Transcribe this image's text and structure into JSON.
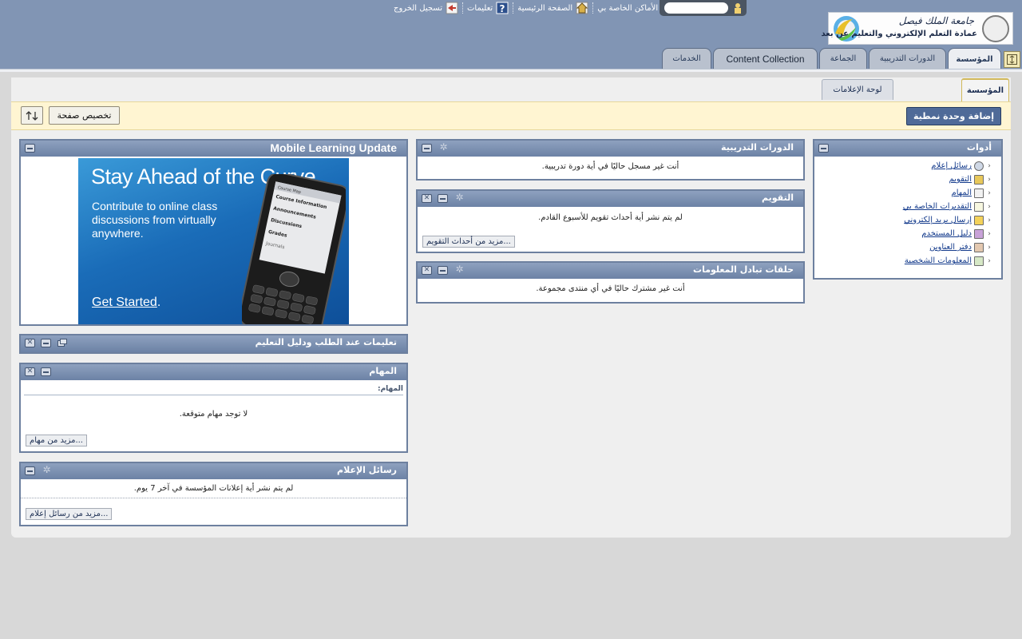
{
  "header": {
    "top_links": [
      {
        "label": "تسجيل الخروج",
        "icon": "logout-icon"
      },
      {
        "label": "تعليمات",
        "icon": "help-icon"
      },
      {
        "label": "الصفحة الرئيسية",
        "icon": "home-icon"
      },
      {
        "label": "الأماكن الخاصة بي",
        "icon": "my-places-icon"
      }
    ],
    "logo": {
      "line1": "جامعة الملك فيصل",
      "line2": "عمادة التعلم الإلكتروني والتعليم عن بعد"
    }
  },
  "tabs": [
    {
      "label": "المؤسسة",
      "active": true
    },
    {
      "label": "الدورات التدريبية",
      "active": false
    },
    {
      "label": "الجماعة",
      "active": false
    },
    {
      "label": "Content Collection",
      "active": false
    },
    {
      "label": "الخدمات",
      "active": false
    }
  ],
  "subtabs": [
    {
      "label": "المؤسسة",
      "active": true
    },
    {
      "label": "لوحة الإعلامات",
      "active": false
    }
  ],
  "toolbar": {
    "add_module": "إضافة وحدة نمطية",
    "customize": "تخصيص صفحة"
  },
  "modules": {
    "tools": {
      "title": "أدوات",
      "items": [
        {
          "label": "رسائل إعلام",
          "icon": "announcement-icon"
        },
        {
          "label": "التقويم",
          "icon": "calendar-icon"
        },
        {
          "label": "المهام",
          "icon": "tasks-icon"
        },
        {
          "label": "التقديرات الخاصة بي",
          "icon": "grades-icon"
        },
        {
          "label": "إرسال بريد إلكتروني",
          "icon": "email-icon"
        },
        {
          "label": "دليل المستخدم",
          "icon": "user-directory-icon"
        },
        {
          "label": "دفتر العناوين",
          "icon": "address-book-icon"
        },
        {
          "label": "المعلومات الشخصية",
          "icon": "personal-info-icon"
        }
      ]
    },
    "courses": {
      "title": "الدورات التدريبية",
      "body": "أنت غير مسجل حاليًا في أية دورة تدريبية."
    },
    "calendar": {
      "title": "التقويم",
      "body": "لم يتم نشر أية أحداث تقويم للأسبوع القادم.",
      "more": "مزيد من أحداث التقويم..."
    },
    "discussions": {
      "title": "حلقات تبادل المعلومات",
      "body": "أنت غير مشترك حاليًا في أي منتدى مجموعة."
    },
    "mobile": {
      "title": "Mobile Learning Update",
      "banner_headline": "Stay Ahead of the Curve",
      "banner_sub": "Contribute to online class discussions from virtually anywhere.",
      "banner_cta": "Get Started",
      "banner_cta_suffix": ".",
      "phone_menu": [
        "Course Information",
        "Announcements",
        "Discussions",
        "Grades",
        "Journals"
      ],
      "phone_tabs": [
        "Course Map"
      ]
    },
    "help": {
      "title": "تعليمات عند الطلب ودليل التعليم"
    },
    "tasks": {
      "title": "المهام",
      "label": "المهام:",
      "body": "لا توجد مهام متوقعة.",
      "more": "مزيد من مهام..."
    },
    "announcements": {
      "title": "رسائل الإعلام",
      "body": "لم يتم نشر أية إعلانات المؤسسة في آخر 7 يوم.",
      "more": "مزيد من رسائل إعلام..."
    }
  }
}
